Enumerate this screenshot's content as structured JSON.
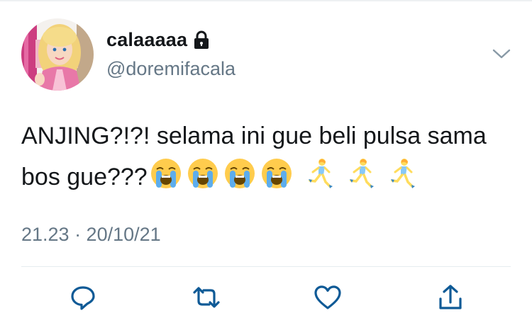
{
  "tweet": {
    "display_name": "calaaaaa",
    "handle": "@doremifacala",
    "text": "ANJING?!?! selama ini gue beli pulsa sama bos gue???",
    "emojis": [
      "loudly-crying-face",
      "loudly-crying-face",
      "loudly-crying-face",
      "loudly-crying-face",
      "woman-running",
      "woman-running",
      "woman-running"
    ],
    "timestamp": "21.23 · 20/10/21"
  },
  "icons": {
    "lock": "lock-icon",
    "more": "chevron-down-icon",
    "actions": [
      "reply-icon",
      "retweet-icon",
      "like-icon",
      "share-icon"
    ]
  },
  "colors": {
    "text_primary": "#14171a",
    "text_secondary": "#657786",
    "action_icon": "#0f5a96",
    "divider": "#e6ecf0"
  }
}
